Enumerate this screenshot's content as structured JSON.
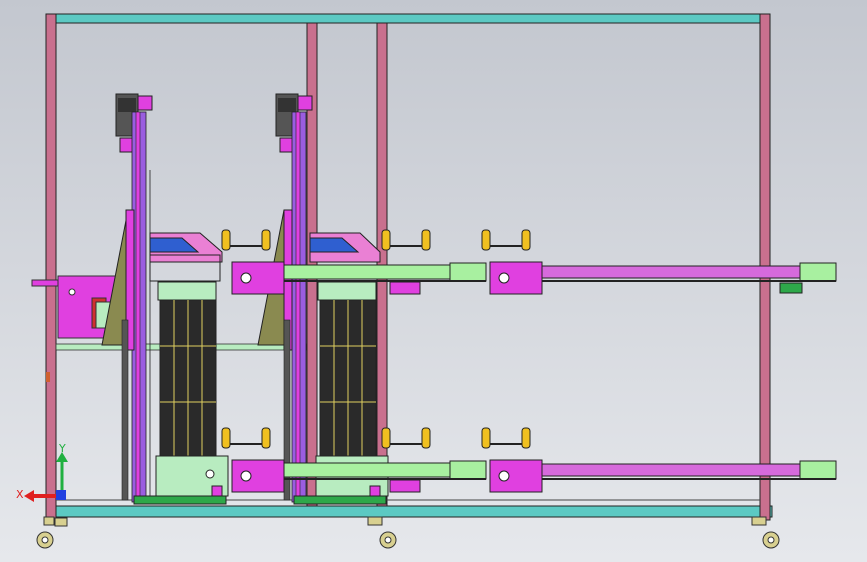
{
  "viewport": {
    "background": "#c8ccd4",
    "gradient_bottom": "#e6e8ec"
  },
  "colors": {
    "frame_pink": "#c9708e",
    "frame_teal": "#5cc9c3",
    "magenta": "#e040e0",
    "violet": "#9a5de0",
    "light_green": "#a8f0a0",
    "green": "#2ea84a",
    "yellow": "#f0c020",
    "olive": "#8a8a50",
    "blue": "#2f5fd0",
    "dark": "#222222",
    "pink_cover": "#ea80d4"
  },
  "triad": {
    "x_label": "X",
    "y_label": "Y",
    "x_color": "#e02020",
    "y_color": "#20b040",
    "z_color": "#2040e0"
  }
}
